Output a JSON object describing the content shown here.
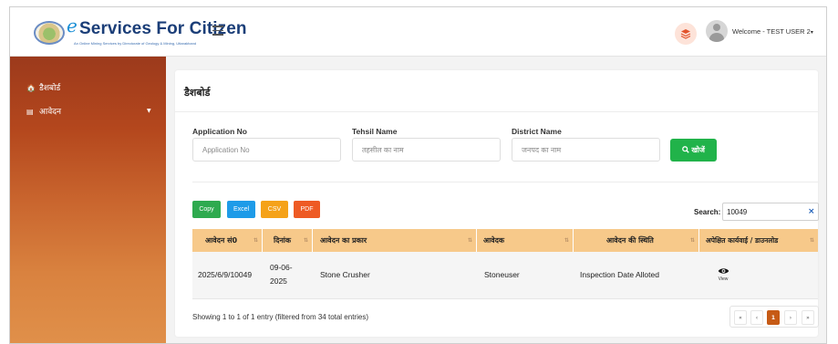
{
  "header": {
    "logo_e": "e",
    "logo_title": "Services For Citizen",
    "logo_subtitle": "An Online Mining Services by Directorate of Geology & Mining, Uttarakhand",
    "welcome_text": "Welcome - TEST USER 2",
    "welcome_caret": "▾"
  },
  "sidebar": {
    "items": [
      {
        "label": "डैशबोर्ड",
        "icon": "home-icon"
      },
      {
        "label": "आवेदन",
        "icon": "document-icon",
        "caret": "▼"
      }
    ]
  },
  "main": {
    "title": "डैशबोर्ड",
    "filters": {
      "application_label": "Application No",
      "application_placeholder": "Application No",
      "tehsil_label": "Tehsil Name",
      "tehsil_placeholder": "तहसील का नाम",
      "district_label": "District Name",
      "district_placeholder": "जनपद का नाम",
      "search_button": "खोजें",
      "search_icon": "search-icon"
    },
    "export_buttons": [
      {
        "label": "Copy",
        "color": "#2eaa4f"
      },
      {
        "label": "Excel",
        "color": "#1e9be8"
      },
      {
        "label": "CSV",
        "color": "#f5a219"
      },
      {
        "label": "PDF",
        "color": "#ee5a24"
      }
    ],
    "search": {
      "label": "Search:",
      "value": "10049",
      "clear": "×"
    },
    "table": {
      "columns": [
        "आवेदन सं0",
        "दिनांक",
        "आवेदन का प्रकार",
        "आवेदक",
        "आवेदन की स्थिति",
        "अपेक्षित कार्यवाई / डाउनलोड"
      ],
      "sort_glyph": "⇅",
      "rows": [
        {
          "application_no": "2025/6/9/10049",
          "date_line1": "09-06-",
          "date_line2": "2025",
          "type": "Stone Crusher",
          "applicant": "Stoneuser",
          "status": "Inspection Date Alloted",
          "action_label": "View"
        }
      ]
    },
    "info": "Showing 1 to 1 of 1 entry (filtered from 34 total entries)",
    "pagination": {
      "first": "«",
      "prev": "‹",
      "current": "1",
      "next": "›",
      "last": "»"
    }
  },
  "colors": {
    "accent": "#c65a15",
    "header_row": "#f7c98a",
    "search_button": "#21b34a"
  }
}
